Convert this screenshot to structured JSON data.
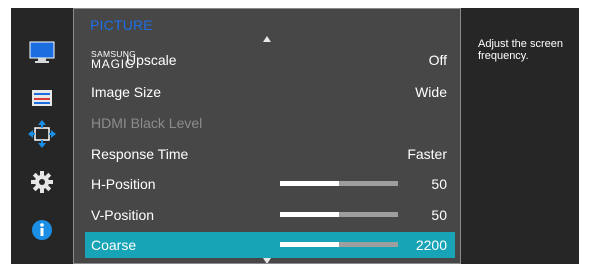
{
  "menu": {
    "title": "PICTURE",
    "items": [
      {
        "label_brand_top": "SAMSUNG",
        "label_brand_bottom": "MAGIC",
        "label": "Upscale",
        "value": "Off",
        "state": "normal"
      },
      {
        "label": "Image Size",
        "value": "Wide",
        "state": "normal"
      },
      {
        "label": "HDMI Black Level",
        "value": "",
        "state": "disabled"
      },
      {
        "label": "Response Time",
        "value": "Faster",
        "state": "normal"
      },
      {
        "label": "H-Position",
        "value": "50",
        "level_fraction": 0.5,
        "state": "normal"
      },
      {
        "label": "V-Position",
        "value": "50",
        "level_fraction": 0.5,
        "state": "normal"
      },
      {
        "label": "Coarse",
        "value": "2200",
        "level_fraction": 0.5,
        "state": "selected"
      }
    ]
  },
  "help_text": "Adjust the screen frequency.",
  "icons": [
    "picture-monitor-icon",
    "onscreen-display-icon",
    "position-arrows-icon",
    "gear-icon",
    "info-icon"
  ],
  "colors": {
    "title": "#1e6fe6",
    "selected_row": "#17a4b6",
    "panel": "#474747",
    "background": "#262626"
  }
}
